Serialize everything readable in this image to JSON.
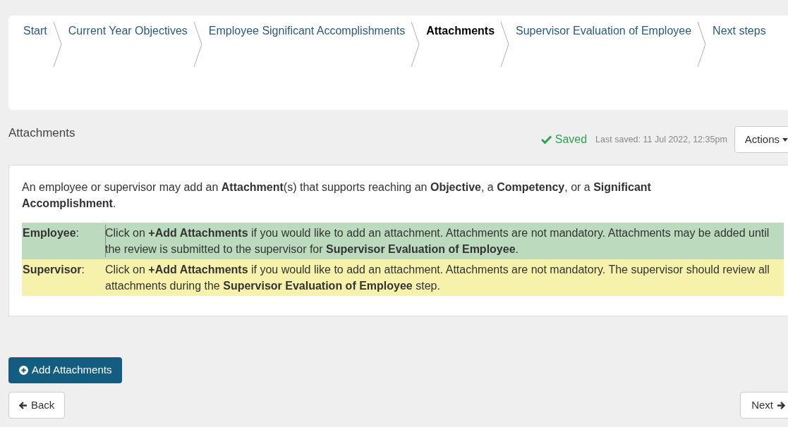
{
  "steps": [
    {
      "label": "Start",
      "selected": false
    },
    {
      "label": "Current Year Objectives",
      "selected": false
    },
    {
      "label": "Employee Significant Accomplishments",
      "selected": false
    },
    {
      "label": "Attachments",
      "selected": true
    },
    {
      "label": "Supervisor Evaluation of Employee",
      "selected": false
    },
    {
      "label": "Next steps",
      "selected": false
    }
  ],
  "section_title": "Attachments",
  "save_status": "Saved",
  "last_saved": "Last saved: 11 Jul 2022, 12:35pm",
  "actions_button": "Actions",
  "intro": "An employee or supervisor may add an **Attachment**(s) that supports reaching an **Objective**, a **Competency**, or a **Significant Accomplishment**.",
  "roles": [
    {
      "role": "Employee",
      "separator": ":",
      "color": "#bcdbbe",
      "text": "Click on **+Add Attachments** if you would like to add an attachment. Attachments are not mandatory. Attachments may be added until the review is submitted to the supervisor for **Supervisor Evaluation of Employee**."
    },
    {
      "role": "Supervisor",
      "separator": ":",
      "color": "#f6f2ac",
      "text": "Click on **+Add Attachments** if you would like to add an attachment. Attachments are not mandatory. The supervisor should review all attachments during the **Supervisor Evaluation of Employee** step."
    }
  ],
  "add_button": "Add Attachments",
  "back_button": "Back",
  "next_button": "Next"
}
